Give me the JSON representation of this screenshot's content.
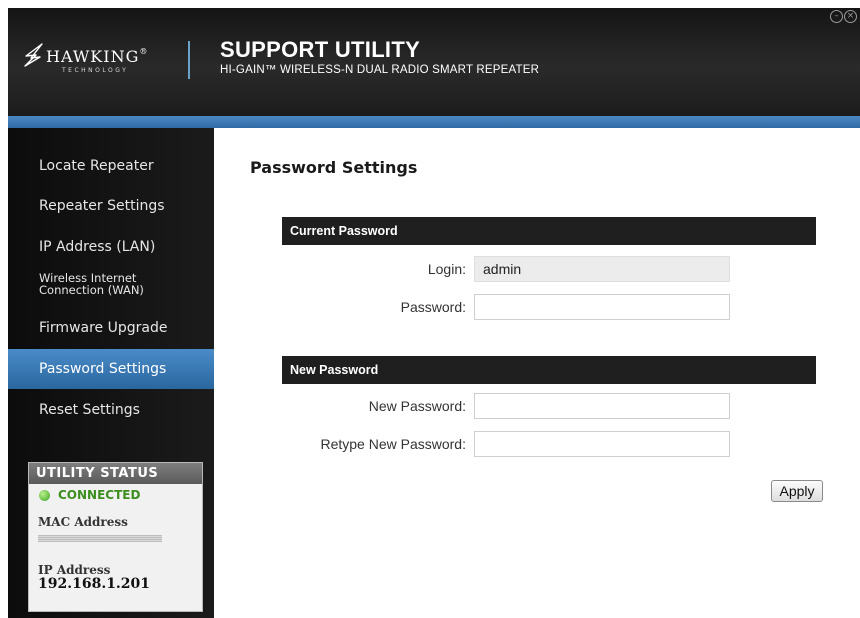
{
  "header": {
    "brand": "HAWKING",
    "brand_mark": "®",
    "brand_sub": "TECHNOLOGY",
    "title": "SUPPORT UTILITY",
    "subtitle": "HI-GAIN™ WIRELESS-N DUAL RADIO SMART REPEATER",
    "minimize_icon": "minimize-icon",
    "close_icon": "close-icon"
  },
  "sidebar": {
    "items": [
      {
        "label": "Locate Repeater"
      },
      {
        "label": "Repeater Settings"
      },
      {
        "label": "IP Address (LAN)"
      },
      {
        "label": "Wireless Internet\nConnection (WAN)"
      },
      {
        "label": "Firmware Upgrade"
      },
      {
        "label": "Password Settings",
        "active": true
      },
      {
        "label": "Reset Settings"
      }
    ],
    "status": {
      "title": "UTILITY STATUS",
      "connection": "CONNECTED",
      "mac_label": "MAC Address",
      "ip_label": "IP Address",
      "ip_value": "192.168.1.201"
    }
  },
  "main": {
    "title": "Password Settings",
    "current_section": "Current Password",
    "login_label": "Login:",
    "login_value": "admin",
    "password_label": "Password:",
    "password_value": "",
    "new_section": "New Password",
    "new_password_label": "New Password:",
    "new_password_value": "",
    "retype_label": "Retype New Password:",
    "retype_value": "",
    "apply_label": "Apply"
  },
  "colors": {
    "accent": "#3a78b3",
    "header_bg": "#1f1f1f",
    "connected": "#3c8e1f"
  }
}
